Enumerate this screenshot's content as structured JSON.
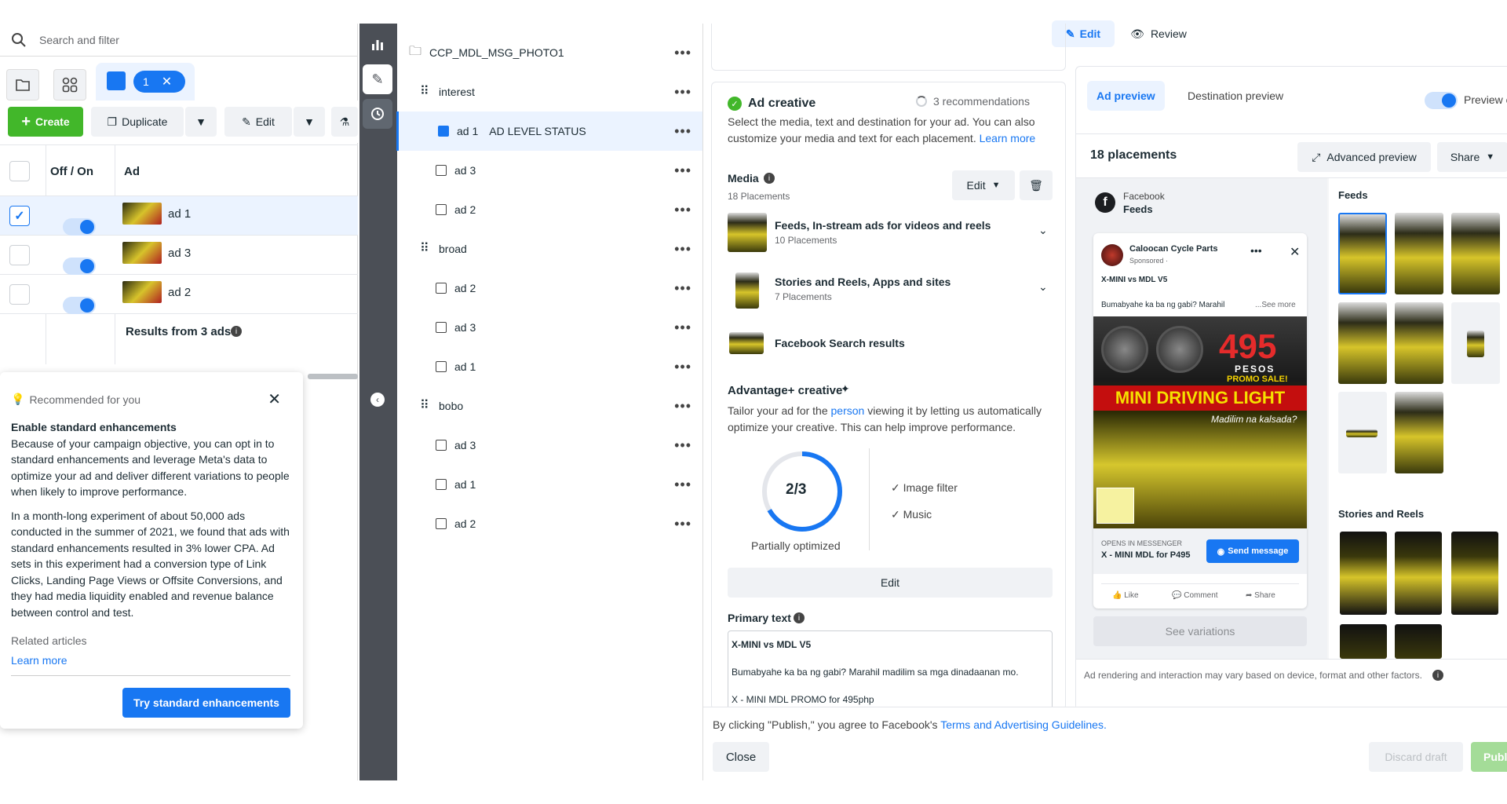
{
  "left": {
    "search_placeholder": "Search and filter",
    "selected_count": "1",
    "toolbar": {
      "create": "Create",
      "duplicate": "Duplicate",
      "edit": "Edit"
    },
    "table": {
      "col_off_on": "Off / On",
      "col_ad": "Ad",
      "rows": [
        {
          "name": "ad 1",
          "checked": true
        },
        {
          "name": "ad 3",
          "checked": false
        },
        {
          "name": "ad 2",
          "checked": false
        }
      ],
      "results": "Results from 3 ads"
    },
    "recommend": {
      "header": "Recommended for you",
      "title": "Enable standard enhancements",
      "p1": "Because of your campaign objective, you can opt in to standard enhancements and leverage Meta's data to optimize your ad and deliver different variations to people when likely to improve performance.",
      "p2": "In a month-long experiment of about 50,000 ads conducted in the summer of 2021, we found that ads with standard enhancements resulted in 3% lower CPA. Ad sets in this experiment had a conversion type of Link Clicks, Landing Page Views or Offsite Conversions, and they had media liquidity enabled and revenue balance between control and test.",
      "related": "Related articles",
      "learn_more": "Learn more",
      "cta": "Try standard enhancements"
    }
  },
  "tree": {
    "campaign": "CCP_MDL_MSG_PHOTO1",
    "items": [
      {
        "label": "interest",
        "type": "adset"
      },
      {
        "label": "ad 1",
        "type": "ad",
        "status": "AD LEVEL STATUS",
        "selected": true
      },
      {
        "label": "ad 3",
        "type": "ad"
      },
      {
        "label": "ad 2",
        "type": "ad"
      },
      {
        "label": "broad",
        "type": "adset"
      },
      {
        "label": "ad 2",
        "type": "ad"
      },
      {
        "label": "ad 3",
        "type": "ad"
      },
      {
        "label": "ad 1",
        "type": "ad"
      },
      {
        "label": "bobo",
        "type": "adset"
      },
      {
        "label": "ad 3",
        "type": "ad"
      },
      {
        "label": "ad 1",
        "type": "ad"
      },
      {
        "label": "ad 2",
        "type": "ad"
      }
    ]
  },
  "top_tabs": {
    "edit": "Edit",
    "review": "Review"
  },
  "creative": {
    "title": "Ad creative",
    "recommendations": "3 recommendations",
    "desc": "Select the media, text and destination for your ad. You can also customize your media and text for each placement.",
    "learn_more": "Learn more",
    "media_label": "Media",
    "media_sub": "18 Placements",
    "edit": "Edit",
    "placements": [
      {
        "title": "Feeds, In-stream ads for videos and reels",
        "sub": "10 Placements"
      },
      {
        "title": "Stories and Reels, Apps and sites",
        "sub": "7 Placements"
      },
      {
        "title": "Facebook Search results",
        "sub": ""
      }
    ],
    "advantage_title": "Advantage+ creative",
    "advantage_desc_1": "Tailor your ad for the",
    "advantage_link": "person",
    "advantage_desc_2": "viewing it by letting us automatically optimize your creative. This can help improve performance.",
    "score": "2/3",
    "score_fraction": 0.667,
    "score_label": "Partially optimized",
    "features": [
      "Image filter",
      "Music"
    ],
    "edit_button": "Edit",
    "primary_text_label": "Primary text",
    "primary_lines": [
      "X-MINI vs MDL V5",
      "Bumabyahe ka ba ng gabi? Marahil madilim sa mga dinadaanan mo.",
      "X - MINI MDL PROMO for 495php"
    ]
  },
  "preview": {
    "tab_ad": "Ad preview",
    "tab_dest": "Destination preview",
    "toggle_label": "Preview c",
    "placements_count": "18 placements",
    "advanced": "Advanced preview",
    "share": "Share",
    "platform": "Facebook",
    "placement": "Feeds",
    "page_name": "Caloocan Cycle Parts",
    "sponsored": "Sponsored · ",
    "headline": "X-MINI vs MDL V5",
    "body": "Bumabyahe ka ba ng gabi? Marahil",
    "see_more": "...See more",
    "img_price": "495",
    "img_pesos": "PESOS",
    "img_promo": "PROMO SALE!",
    "img_banner": "MINI DRIVING LIGHT",
    "img_sub": "Madilim na kalsada?",
    "opens_in": "OPENS IN MESSENGER",
    "cta_headline": "X - MINI MDL for P495",
    "send_message": "Send message",
    "like": "Like",
    "comment": "Comment",
    "share_action": "Share",
    "see_variations": "See variations",
    "feeds_heading": "Feeds",
    "stories_heading": "Stories and Reels",
    "disclaimer": "Ad rendering and interaction may vary based on device, format and other factors."
  },
  "footer": {
    "text": "By clicking \"Publish,\" you agree to Facebook's",
    "link": "Terms and Advertising Guidelines.",
    "close": "Close",
    "discard": "Discard draft",
    "publish": "Publi"
  },
  "colors": {
    "primary": "#1877f2",
    "green": "#42b72a",
    "sidebar": "#4b4f56",
    "selected_row": "#ebf3ff"
  }
}
